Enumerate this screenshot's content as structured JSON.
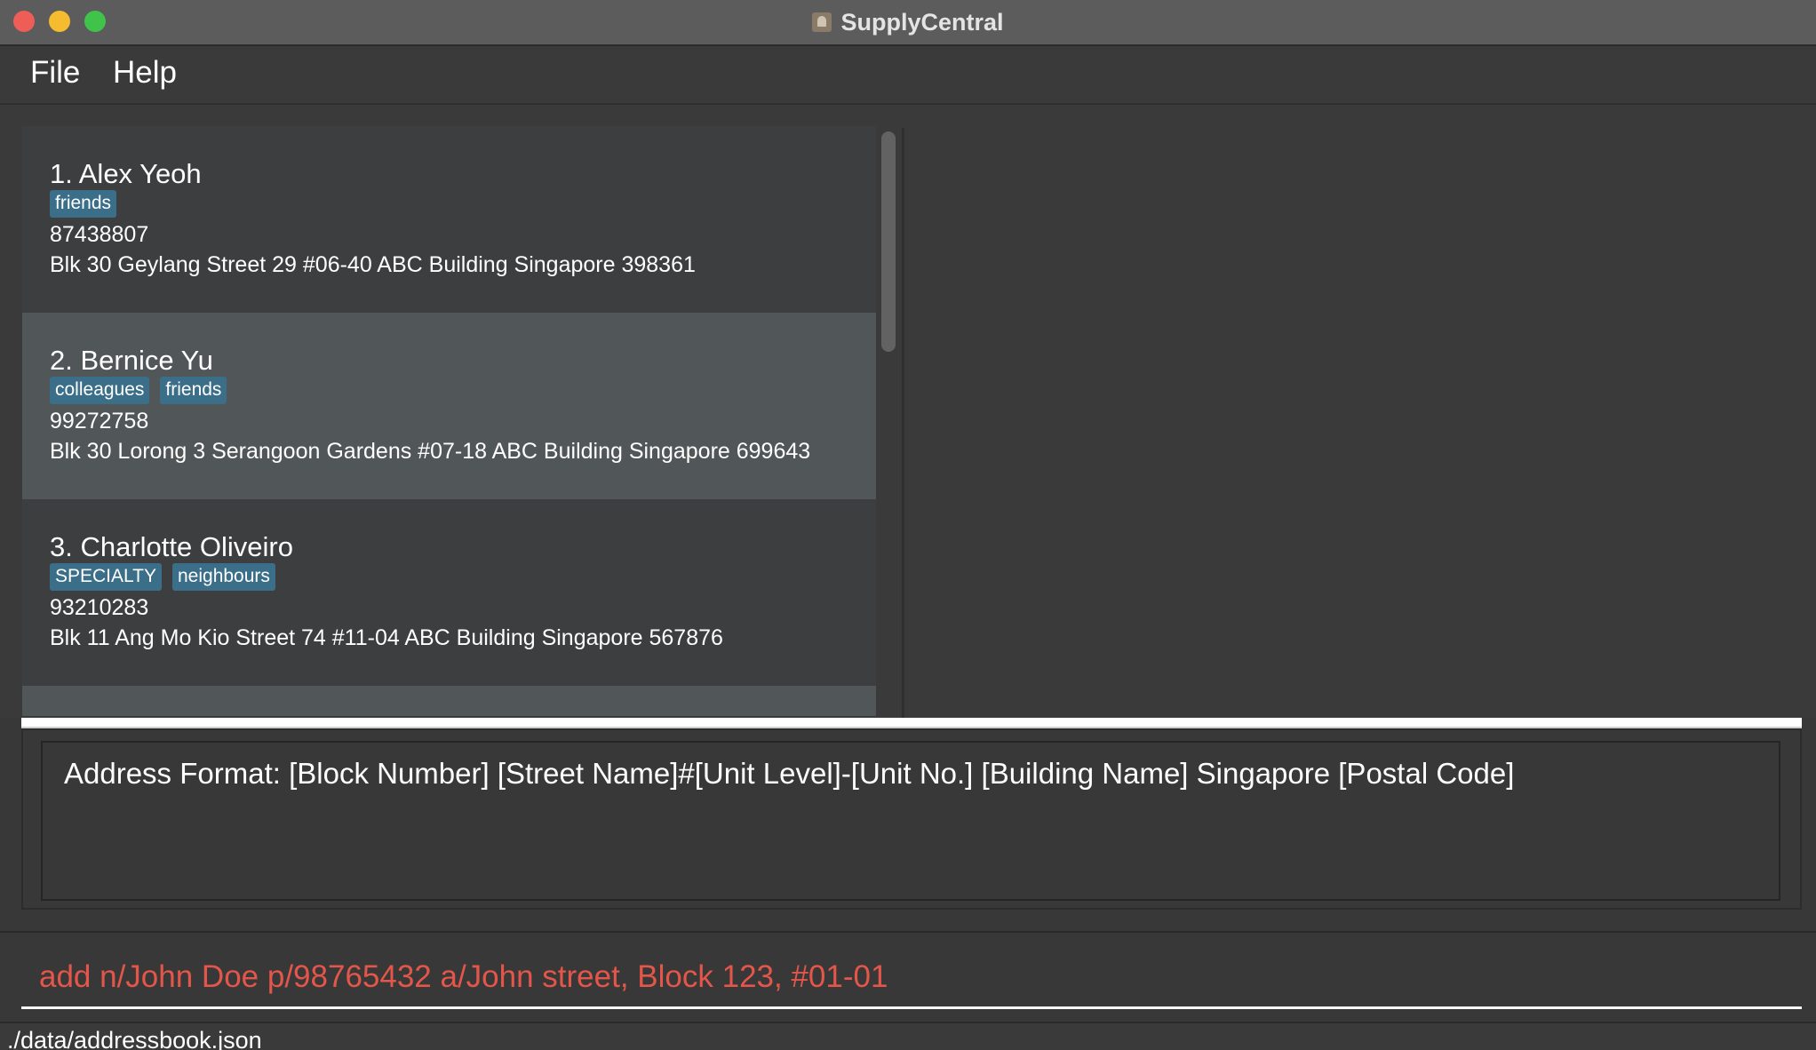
{
  "window": {
    "title": "SupplyCentral"
  },
  "menu": {
    "items": [
      {
        "label": "File"
      },
      {
        "label": "Help"
      }
    ]
  },
  "persons": [
    {
      "name": "1. Alex Yeoh",
      "tags": [
        "friends"
      ],
      "phone": "87438807",
      "address": "Blk 30 Geylang Street 29 #06-40 ABC Building Singapore 398361"
    },
    {
      "name": "2. Bernice Yu",
      "tags": [
        "colleagues",
        "friends"
      ],
      "phone": "99272758",
      "address": "Blk 30 Lorong 3 Serangoon Gardens #07-18 ABC Building Singapore 699643"
    },
    {
      "name": "3. Charlotte Oliveiro",
      "tags": [
        "SPECIALTY",
        "neighbours"
      ],
      "phone": "93210283",
      "address": "Blk 11 Ang Mo Kio Street 74 #11-04 ABC Building Singapore 567876"
    }
  ],
  "result": {
    "text": "Address Format: [Block Number] [Street Name]#[Unit Level]-[Unit No.] [Building Name] Singapore [Postal Code]"
  },
  "command": {
    "value": "add n/John Doe p/98765432 a/John street, Block 123, #01-01"
  },
  "status": {
    "path": "./data/addressbook.json"
  },
  "colors": {
    "tag_bg": "#3b6e88",
    "command_error_text": "#e4564a",
    "card_selected_bg": "#515658"
  }
}
